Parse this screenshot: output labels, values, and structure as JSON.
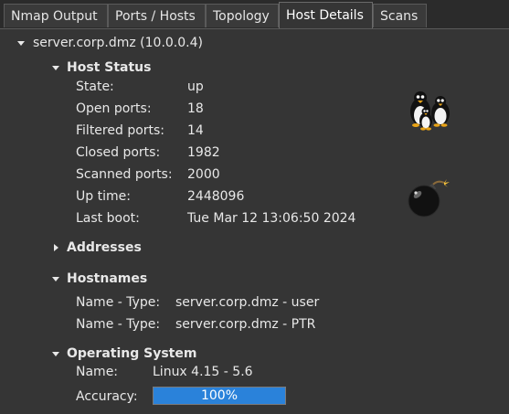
{
  "tabs": [
    {
      "label": "Nmap Output",
      "active": false
    },
    {
      "label": "Ports / Hosts",
      "active": false
    },
    {
      "label": "Topology",
      "active": false
    },
    {
      "label": "Host Details",
      "active": true
    },
    {
      "label": "Scans",
      "active": false
    }
  ],
  "host": {
    "title": "server.corp.dmz (10.0.0.4)"
  },
  "host_status": {
    "heading": "Host Status",
    "rows": [
      {
        "label": "State:",
        "value": "up"
      },
      {
        "label": "Open ports:",
        "value": "18"
      },
      {
        "label": "Filtered ports:",
        "value": "14"
      },
      {
        "label": "Closed ports:",
        "value": "1982"
      },
      {
        "label": "Scanned ports:",
        "value": "2000"
      },
      {
        "label": "Up time:",
        "value": "2448096"
      },
      {
        "label": "Last boot:",
        "value": "Tue Mar 12 13:06:50 2024"
      }
    ],
    "os_icon": "linux-penguins-icon",
    "vulnerability_icon": "bomb-icon"
  },
  "addresses": {
    "heading": "Addresses",
    "expanded": false
  },
  "hostnames": {
    "heading": "Hostnames",
    "rows": [
      {
        "label": "Name - Type:",
        "value": "server.corp.dmz - user"
      },
      {
        "label": "Name - Type:",
        "value": "server.corp.dmz - PTR"
      }
    ]
  },
  "operating_system": {
    "heading": "Operating System",
    "name_label": "Name:",
    "name_value": "Linux 4.15 - 5.6",
    "accuracy_label": "Accuracy:",
    "accuracy_percent": 100,
    "accuracy_text": "100%"
  },
  "colors": {
    "progress_fill": "#2a82da",
    "background": "#353535"
  }
}
